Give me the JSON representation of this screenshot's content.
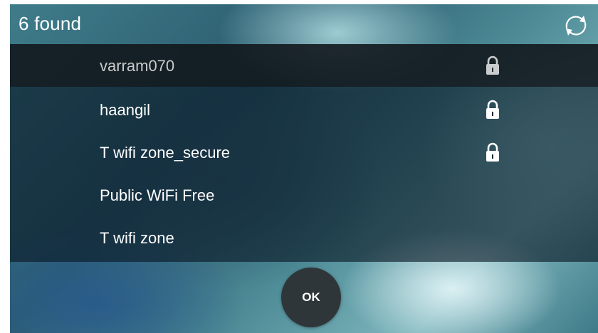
{
  "header": {
    "found_text": "6 found",
    "refresh_icon": "refresh-icon"
  },
  "networks": [
    {
      "ssid": "varram070",
      "secured": true,
      "selected": true
    },
    {
      "ssid": "haangil",
      "secured": true,
      "selected": false
    },
    {
      "ssid": "T wifi zone_secure",
      "secured": true,
      "selected": false
    },
    {
      "ssid": "Public WiFi Free",
      "secured": false,
      "selected": false
    },
    {
      "ssid": "T wifi zone",
      "secured": false,
      "selected": false
    }
  ],
  "footer": {
    "ok_label": "OK"
  },
  "colors": {
    "selected_row": "#1e2224",
    "list_background": "#0b1a28",
    "ok_button": "#2f3639",
    "text": "#ffffff",
    "selected_text": "#c9cccd"
  }
}
